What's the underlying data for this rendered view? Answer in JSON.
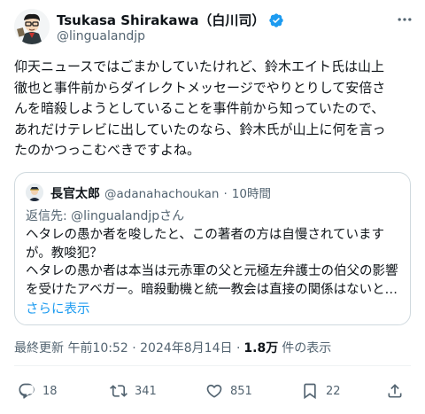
{
  "author": {
    "display_name": "Tsukasa Shirakawa（白川司）",
    "handle": "@lingualandjp",
    "verified": true,
    "avatar_icon": "cartoon-man-avatar-icon"
  },
  "tweet": {
    "lines": [
      "仰天ニュースではごまかしていたけれど、鈴木エイト氏は山上",
      "徹也と事件前からダイレクトメッセージでやりとりして安倍さ",
      "んを暗殺しようとしていることを事件前から知っていたので、",
      "あれだけテレビに出していたのなら、鈴木氏が山上に何を言っ",
      "たのかつっこむべきですよね。"
    ]
  },
  "quote": {
    "name": "長官太郎",
    "handle": "@adanahachoukan",
    "time": "10時間",
    "reply_prefix": "返信先: ",
    "reply_mention": "@lingualandjp",
    "reply_suffix": "さん",
    "lines": [
      "ヘタレの愚か者を唆したと、この著者の方は自慢されています",
      "が。教唆犯？",
      "ヘタレの愚か者は本当は元赤軍の父と元極左弁護士の伯父の影響",
      "を受けたアベガー。暗殺動機と統一教会は直接の関係はないと…"
    ],
    "show_more": "さらに表示"
  },
  "meta": {
    "last_updated": "最終更新 午前10:52 · 2024年8月14日 ·",
    "views_count": "1.8万",
    "views_label": "件の表示"
  },
  "actions": {
    "replies": "18",
    "reposts": "341",
    "likes": "851",
    "views": "22"
  },
  "colors": {
    "accent": "#1d9bf0",
    "text": "#0f1419",
    "muted": "#536471",
    "border": "#cfd9de"
  }
}
